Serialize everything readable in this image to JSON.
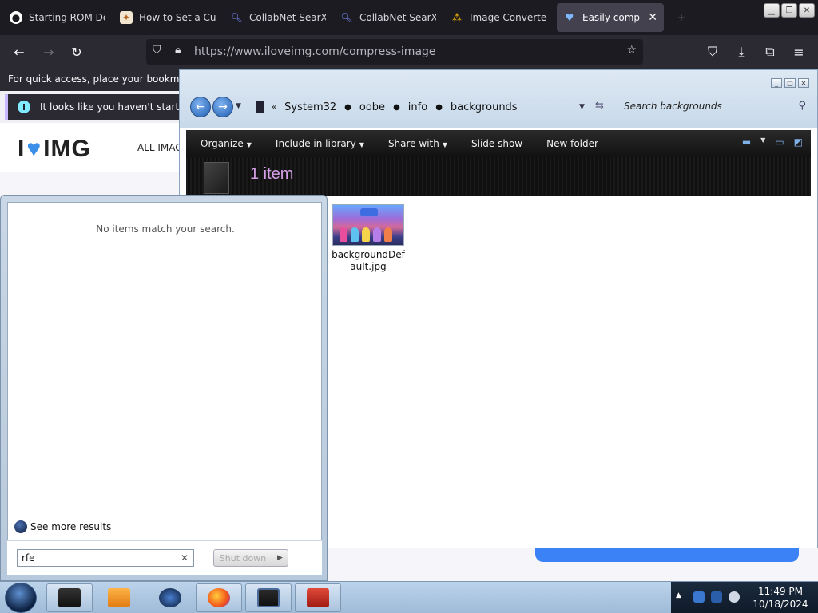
{
  "browser": {
    "tabs": [
      {
        "title": "Starting ROM Do",
        "icon": "github-icon"
      },
      {
        "title": "How to Set a Cus",
        "icon": "site-icon"
      },
      {
        "title": "CollabNet SearXN",
        "icon": "search-icon"
      },
      {
        "title": "CollabNet SearXN",
        "icon": "search-icon"
      },
      {
        "title": "Image Converter",
        "icon": "dots-icon"
      },
      {
        "title": "Easily compres",
        "icon": "heart-icon",
        "active": true
      }
    ],
    "url": "https://www.iloveimg.com/compress-image",
    "bookmarks_text": "For quick access, place your bookmarks h",
    "notice_text": "It looks like you haven't started Fir"
  },
  "website": {
    "logo_left": "I",
    "logo_right": "IMG",
    "nav_all": "ALL IMAG"
  },
  "explorer": {
    "breadcrumb": [
      "System32",
      "oobe",
      "info",
      "backgrounds"
    ],
    "breadcrumb_overflow": "«",
    "search_placeholder": "Search backgrounds",
    "commands": {
      "organize": "Organize",
      "include": "Include in library",
      "share": "Share with",
      "slideshow": "Slide show",
      "newfolder": "New folder"
    },
    "item_count": "1 item",
    "file": {
      "name": "backgroundDefault.jpg"
    }
  },
  "startmenu": {
    "no_items": "No items match your search.",
    "see_more": "See more results",
    "search_value": "rfe",
    "shutdown_label": "Shut down"
  },
  "taskbar": {
    "time": "11:49 PM",
    "date": "10/18/2024"
  },
  "colors": {
    "accent_blue": "#3a82f6",
    "explorer_dark": "#111111",
    "item_count": "#d6a0e8"
  }
}
